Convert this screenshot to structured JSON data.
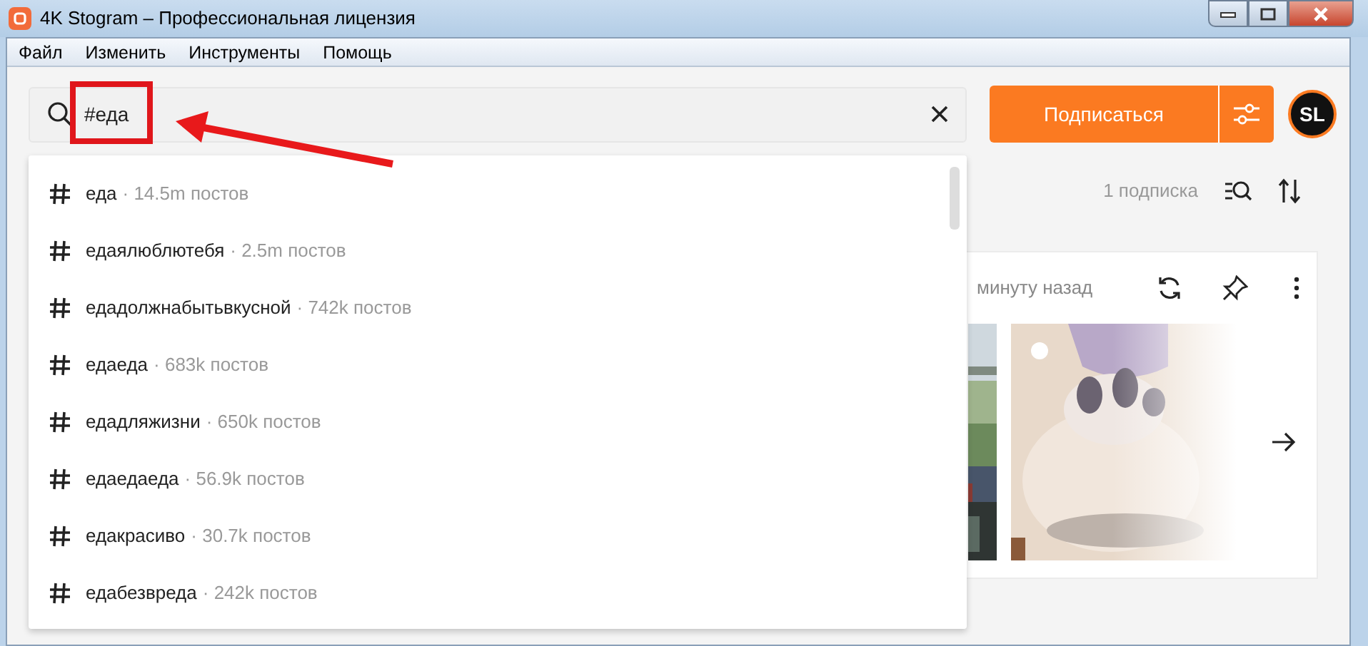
{
  "window": {
    "title": "4K Stogram – Профессиональная лицензия"
  },
  "menu": [
    "Файл",
    "Изменить",
    "Инструменты",
    "Помощь"
  ],
  "search": {
    "value": "#еда"
  },
  "subscribe_button": "Подписаться",
  "avatar": "SL",
  "suggestions": [
    {
      "tag": "еда",
      "count": "· 14.5m постов"
    },
    {
      "tag": "едаялюблютебя",
      "count": "· 2.5m постов"
    },
    {
      "tag": "едадолжнабытьвкусной",
      "count": "· 742k постов"
    },
    {
      "tag": "едаеда",
      "count": "· 683k постов"
    },
    {
      "tag": "едадляжизни",
      "count": "· 650k постов"
    },
    {
      "tag": "едаедаеда",
      "count": "· 56.9k постов"
    },
    {
      "tag": "едакрасиво",
      "count": "· 30.7k постов"
    },
    {
      "tag": "едабезвреда",
      "count": "· 242k постов"
    }
  ],
  "subscriptions_count": "1 подписка",
  "card": {
    "updated": "минуту назад"
  }
}
